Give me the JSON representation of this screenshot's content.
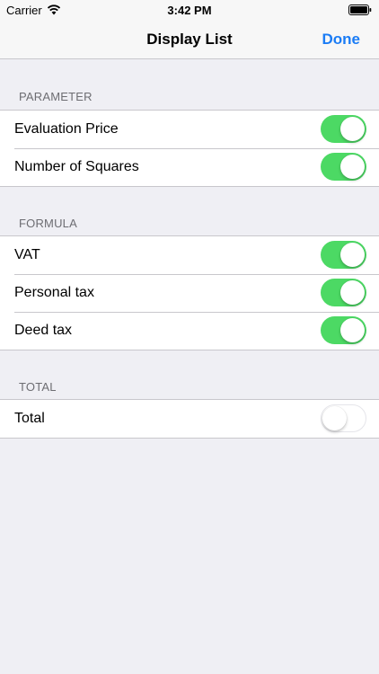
{
  "status_bar": {
    "carrier": "Carrier",
    "time": "3:42 PM",
    "wifi_icon": "wifi-icon",
    "battery_icon": "battery-icon"
  },
  "nav": {
    "title": "Display List",
    "done_label": "Done"
  },
  "sections": [
    {
      "header": "PARAMETER",
      "items": [
        {
          "label": "Evaluation Price",
          "on": true
        },
        {
          "label": "Number of Squares",
          "on": true
        }
      ]
    },
    {
      "header": "FORMULA",
      "items": [
        {
          "label": "VAT",
          "on": true
        },
        {
          "label": "Personal tax",
          "on": true
        },
        {
          "label": "Deed tax",
          "on": true
        }
      ]
    },
    {
      "header": "TOTAL",
      "items": [
        {
          "label": "Total",
          "on": false
        }
      ]
    }
  ],
  "colors": {
    "accent": "#1b7cf5",
    "switch_on": "#4cd964",
    "background": "#efeff4"
  }
}
